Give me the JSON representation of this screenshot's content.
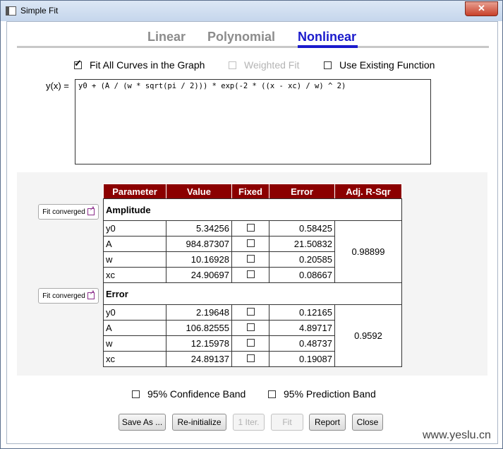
{
  "window": {
    "title": "Simple Fit",
    "close_glyph": "✕"
  },
  "tabs": [
    {
      "label": "Linear",
      "active": false
    },
    {
      "label": "Polynomial",
      "active": false
    },
    {
      "label": "Nonlinear",
      "active": true
    }
  ],
  "options": {
    "fit_all": {
      "label": "Fit All Curves in the Graph",
      "checked": true
    },
    "weighted": {
      "label": "Weighted Fit",
      "checked": false,
      "disabled": true
    },
    "existing": {
      "label": "Use Existing Function",
      "checked": false
    }
  },
  "formula": {
    "label": "y(x) =",
    "value": "y0 + (A / (w * sqrt(pi / 2))) * exp(-2 * ((x - xc) / w) ^ 2)"
  },
  "table": {
    "headers": [
      "Parameter",
      "Value",
      "Fixed",
      "Error",
      "Adj. R-Sqr"
    ],
    "groups": [
      {
        "name": "Amplitude",
        "status": "Fit converged",
        "adj_r_sqr": "0.98899",
        "rows": [
          {
            "param": "y0",
            "value": "5.34256",
            "error": "0.58425"
          },
          {
            "param": "A",
            "value": "984.87307",
            "error": "21.50832"
          },
          {
            "param": "w",
            "value": "10.16928",
            "error": "0.20585"
          },
          {
            "param": "xc",
            "value": "24.90697",
            "error": "0.08667"
          }
        ]
      },
      {
        "name": "Error",
        "status": "Fit converged",
        "adj_r_sqr": "0.9592",
        "rows": [
          {
            "param": "y0",
            "value": "2.19648",
            "error": "0.12165"
          },
          {
            "param": "A",
            "value": "106.82555",
            "error": "4.89717"
          },
          {
            "param": "w",
            "value": "12.15978",
            "error": "0.48737"
          },
          {
            "param": "xc",
            "value": "24.89137",
            "error": "0.19087"
          }
        ]
      }
    ]
  },
  "bands": {
    "confidence": {
      "label": "95% Confidence Band",
      "checked": false
    },
    "prediction": {
      "label": "95% Prediction Band",
      "checked": false
    }
  },
  "buttons": {
    "save_as": "Save As ...",
    "reinit": "Re-initialize",
    "one_iter": "1 Iter.",
    "fit": "Fit",
    "report": "Report",
    "close": "Close"
  },
  "watermark": "www.yeslu.cn"
}
